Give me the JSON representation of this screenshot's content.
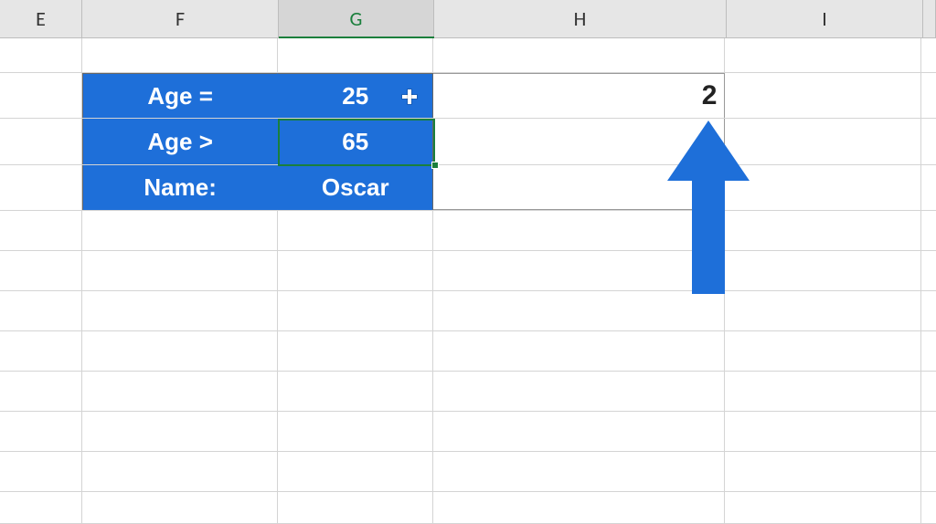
{
  "columns": {
    "E": "E",
    "F": "F",
    "G": "G",
    "H": "H",
    "I": "I"
  },
  "selected_column": "G",
  "active_cell": "G3",
  "criteria": {
    "row2": {
      "label": "Age =",
      "value": "25",
      "result": "2"
    },
    "row3": {
      "label": "Age >",
      "value": "65"
    },
    "row4": {
      "label": "Name:",
      "value": "Oscar"
    }
  },
  "colors": {
    "highlight_fill": "#1e6fd9",
    "highlight_text": "#ffffff",
    "selection_border": "#1a7f3c",
    "arrow_fill": "#1e6fd9"
  },
  "cursor_icon": "plus-fill-cursor",
  "annotation": "up-arrow-pointing-to-H2"
}
